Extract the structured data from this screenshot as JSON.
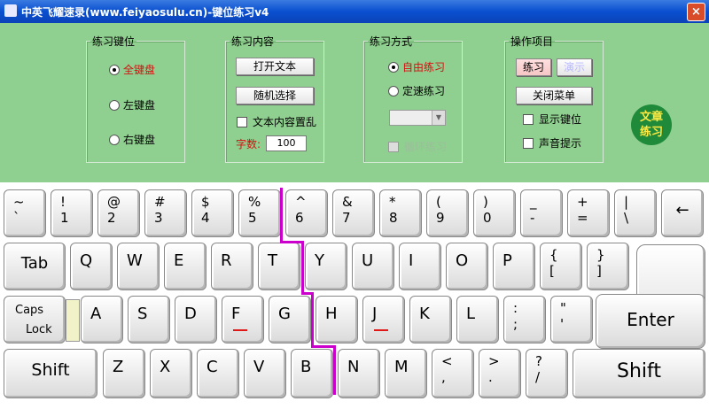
{
  "window": {
    "title": "中英飞耀速录(www.feiyaosulu.cn)-键位练习v4",
    "close": "×"
  },
  "group_keys": {
    "legend": "练习键位",
    "options": [
      "全键盘",
      "左键盘",
      "右键盘"
    ],
    "selected": 0
  },
  "group_content": {
    "legend": "练习内容",
    "open_text": "打开文本",
    "random_select": "随机选择",
    "shuffle_label": "文本内容置乱",
    "word_count_label": "字数:",
    "word_count_value": "100"
  },
  "group_mode": {
    "legend": "练习方式",
    "options": [
      "自由练习",
      "定速练习"
    ],
    "selected": 0,
    "loop_label": "循环练习"
  },
  "group_actions": {
    "legend": "操作项目",
    "practice": "练习",
    "demo": "演示",
    "close_menu": "关闭菜单",
    "show_keys": "显示键位",
    "sound": "声音提示"
  },
  "article_badge": {
    "line1": "文章",
    "line2": "练习"
  },
  "keyboard": {
    "row1": [
      {
        "t": "~",
        "b": "`"
      },
      {
        "t": "!",
        "b": "1"
      },
      {
        "t": "@",
        "b": "2"
      },
      {
        "t": "#",
        "b": "3"
      },
      {
        "t": "$",
        "b": "4"
      },
      {
        "t": "%",
        "b": "5"
      },
      {
        "t": "^",
        "b": "6"
      },
      {
        "t": "&",
        "b": "7"
      },
      {
        "t": "*",
        "b": "8"
      },
      {
        "t": "(",
        "b": "9"
      },
      {
        "t": ")",
        "b": "0"
      },
      {
        "t": "_",
        "b": "-"
      },
      {
        "t": "+",
        "b": "="
      },
      {
        "t": "|",
        "b": "\\"
      }
    ],
    "backspace": "←",
    "tab": "Tab",
    "row2": [
      "Q",
      "W",
      "E",
      "R",
      "T",
      "Y",
      "U",
      "I",
      "O",
      "P"
    ],
    "row2_sym": [
      {
        "t": "{",
        "b": "["
      },
      {
        "t": "}",
        "b": "]"
      }
    ],
    "caps_line1": "Caps",
    "caps_line2": "Lock",
    "row3": [
      "A",
      "S",
      "D",
      "F",
      "G",
      "H",
      "J",
      "K",
      "L"
    ],
    "row3_sym": [
      {
        "t": ":",
        "b": ";"
      },
      {
        "t": "\"",
        "b": "'"
      }
    ],
    "enter": "Enter",
    "shift_left": "Shift",
    "row4": [
      "Z",
      "X",
      "C",
      "V",
      "B",
      "N",
      "M"
    ],
    "row4_sym": [
      {
        "t": "<",
        "b": ","
      },
      {
        "t": ">",
        "b": "."
      },
      {
        "t": "?",
        "b": "/"
      }
    ],
    "shift_right": "Shift"
  }
}
